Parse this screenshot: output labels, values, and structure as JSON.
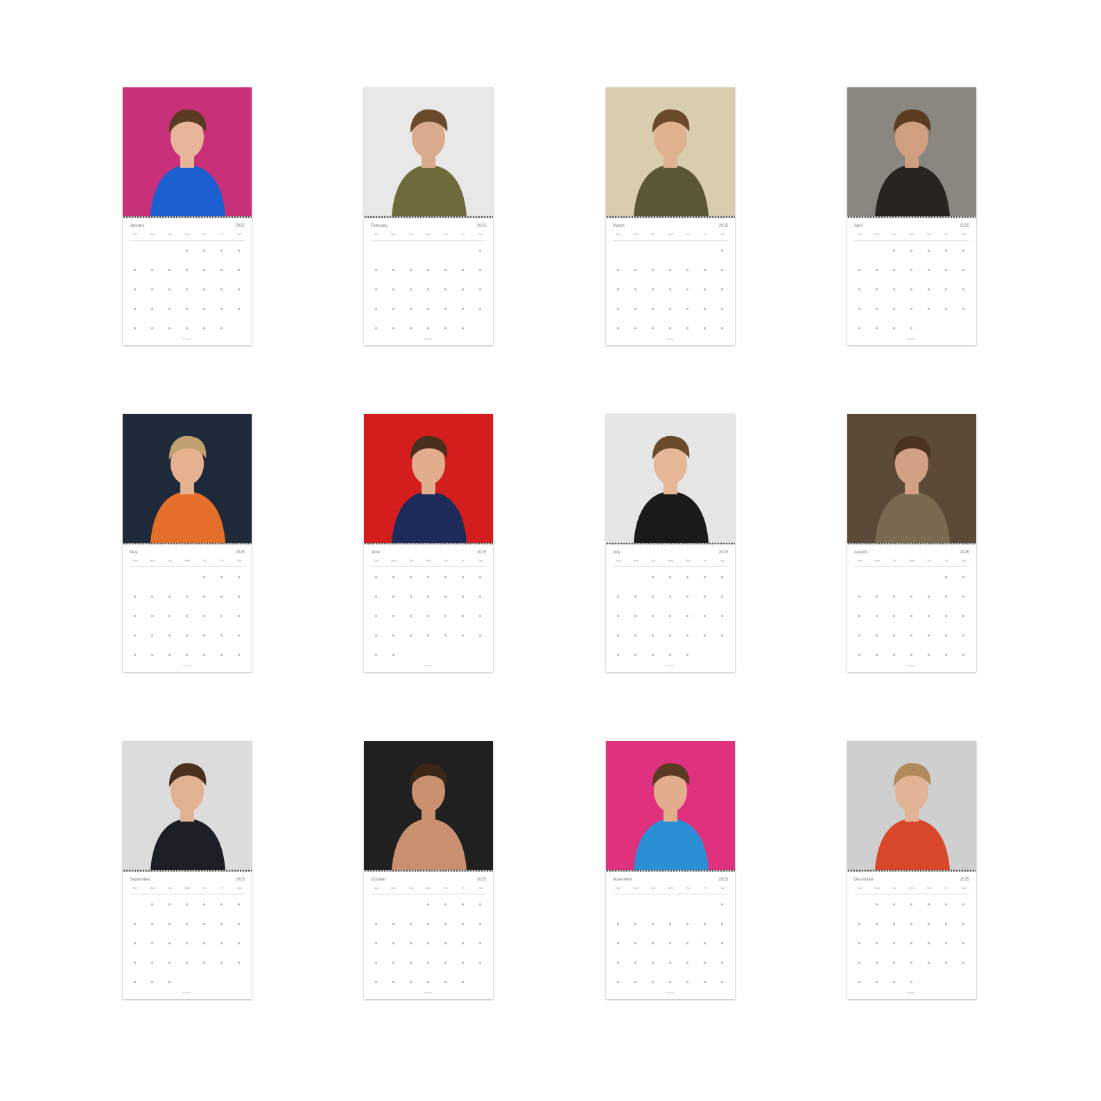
{
  "calendar": {
    "year": "2025",
    "weekdays": [
      "Sun",
      "Mon",
      "Tue",
      "Wed",
      "Thu",
      "Fri",
      "Sat"
    ],
    "months": [
      {
        "name": "January",
        "start": 3,
        "days": 31,
        "bg": "#c8307a"
      },
      {
        "name": "February",
        "start": 6,
        "days": 28,
        "bg": "#e8e8e8"
      },
      {
        "name": "March",
        "start": 6,
        "days": 31,
        "bg": "#d9cdb0"
      },
      {
        "name": "April",
        "start": 2,
        "days": 30,
        "bg": "#8a8680"
      },
      {
        "name": "May",
        "start": 4,
        "days": 31,
        "bg": "#1e2a3a"
      },
      {
        "name": "June",
        "start": 0,
        "days": 30,
        "bg": "#d41e1e"
      },
      {
        "name": "July",
        "start": 2,
        "days": 31,
        "bg": "#e6e6e6"
      },
      {
        "name": "August",
        "start": 5,
        "days": 31,
        "bg": "#5b4a37"
      },
      {
        "name": "September",
        "start": 1,
        "days": 30,
        "bg": "#dcdcdc"
      },
      {
        "name": "October",
        "start": 3,
        "days": 31,
        "bg": "#202020"
      },
      {
        "name": "November",
        "start": 6,
        "days": 30,
        "bg": "#e0317f"
      },
      {
        "name": "December",
        "start": 1,
        "days": 31,
        "bg": "#cfcfcf"
      }
    ]
  }
}
